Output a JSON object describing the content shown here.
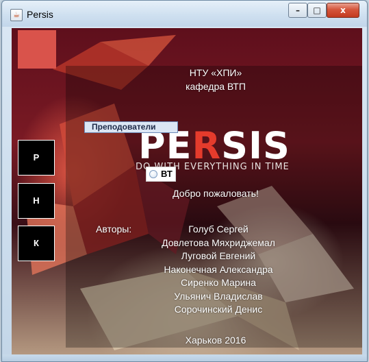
{
  "window": {
    "title": "Persis",
    "controls": {
      "minimize": "–",
      "maximize": "□",
      "close": "x"
    }
  },
  "sidebar": {
    "buttons": [
      {
        "label": "Р"
      },
      {
        "label": "Н"
      },
      {
        "label": "К"
      }
    ]
  },
  "header": {
    "university": "НТУ «ХПИ»",
    "department": "кафедра ВТП"
  },
  "logo": {
    "text_before": "PE",
    "text_highlight": "R",
    "text_after": "SIS",
    "tagline": "DO WITH EVERYTHING IN TIME"
  },
  "menu": {
    "item": "Преподователи"
  },
  "radio": {
    "label": "ВТ",
    "selected": false
  },
  "welcome": "Добро пожаловать!",
  "authors": {
    "label": "Авторы:",
    "names": [
      "Голуб Сергей",
      "Довлетова Мяхриджемал",
      "Луговой Евгений",
      "Наконечная Александра",
      "Сиренко Марина",
      "Ульянич Владислав",
      "Сорочинский Денис"
    ]
  },
  "footer": "Харьков 2016",
  "colors": {
    "accent": "#d9534b",
    "logo_highlight": "#e53b2c",
    "sidebar_bg": "#000000"
  }
}
